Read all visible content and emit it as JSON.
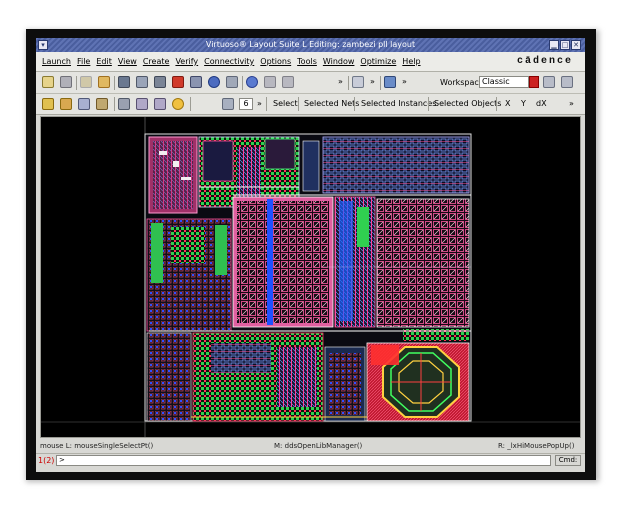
{
  "window": {
    "title": "Virtuoso® Layout Suite L Editing: zambezi pll layout",
    "brand": "cādence",
    "controls": [
      "minimize-icon",
      "maximize-icon",
      "close-icon"
    ]
  },
  "menubar": {
    "items": [
      "Launch",
      "File",
      "Edit",
      "View",
      "Create",
      "Verify",
      "Connectivity",
      "Options",
      "Tools",
      "Window",
      "Optimize",
      "Help"
    ]
  },
  "toolbar1": {
    "workspace_label": "Workspace:",
    "workspace_value": "Classic",
    "overflow": "»"
  },
  "toolbar2": {
    "stepper_value": "6",
    "overflow": "»",
    "labels": [
      "Select",
      "Selected Nets",
      "Selected Instances",
      "Selected Objects",
      "X",
      "Y",
      "dX"
    ]
  },
  "status": {
    "left": "mouse L: mouseSingleSelectPt()",
    "middle": "M: ddsOpenLibManager()",
    "right": "R: _lxHiMousePopUp()"
  },
  "cmd": {
    "number": "1(2)",
    "prompt": ">",
    "label": "Cmd:"
  },
  "colors": {
    "titlebar": "#4f64a6",
    "canvas": "#000000",
    "metal_pink": "#ff4fa8",
    "metal_blue": "#3a6bff",
    "metal_green": "#2cff5a",
    "metal_red": "#ff3030"
  }
}
